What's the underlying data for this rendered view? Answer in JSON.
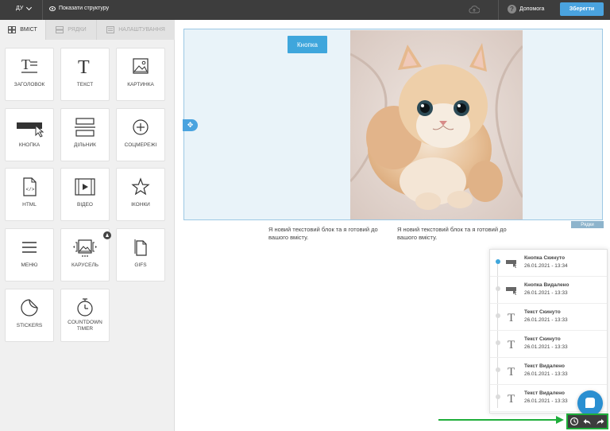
{
  "topbar": {
    "language": "ДУ",
    "show_structure": "Показати структуру",
    "help": "Допомога",
    "save": "Зберегти"
  },
  "tabs": [
    {
      "label": "ВМІСТ",
      "icon": "grid-icon",
      "active": true
    },
    {
      "label": "РЯДКИ",
      "icon": "rows-icon",
      "active": false
    },
    {
      "label": "НАЛАШТУВАННЯ",
      "icon": "settings-icon",
      "active": false
    }
  ],
  "blocks": [
    {
      "label": "ЗАГОЛОВОК",
      "icon": "heading-icon"
    },
    {
      "label": "ТЕКСТ",
      "icon": "text-icon"
    },
    {
      "label": "КАРТИНКА",
      "icon": "image-icon"
    },
    {
      "label": "КНОПКА",
      "icon": "button-icon"
    },
    {
      "label": "ДІЛЬНИК",
      "icon": "divider-icon"
    },
    {
      "label": "СОЦМЕРЕЖІ",
      "icon": "social-icon"
    },
    {
      "label": "HTML",
      "icon": "html-icon"
    },
    {
      "label": "ВІДЕО",
      "icon": "video-icon"
    },
    {
      "label": "ІКОНКИ",
      "icon": "star-icon"
    },
    {
      "label": "МЕНЮ",
      "icon": "menu-icon"
    },
    {
      "label": "КАРУСЕЛЬ",
      "icon": "carousel-icon"
    },
    {
      "label": "GIFS",
      "icon": "gifs-icon"
    },
    {
      "label": "STICKERS",
      "icon": "sticker-icon"
    },
    {
      "label": "COUNTDOWN TIMER",
      "icon": "timer-icon"
    }
  ],
  "canvas": {
    "button_label": "Кнопка",
    "rows_tag": "Рядки",
    "text_block_1": "Я новий текстовий блок та я готовий до вашого вмісту.",
    "text_block_2": "Я новий текстовий блок та я готовий до вашого вмісту."
  },
  "history": [
    {
      "title": "Кнопка Скинуто",
      "time": "26.01.2021 - 13:34",
      "icon": "button-icon",
      "active": true
    },
    {
      "title": "Кнопка Видалено",
      "time": "26.01.2021 - 13:33",
      "icon": "button-icon",
      "active": false
    },
    {
      "title": "Текст Скинуто",
      "time": "26.01.2021 - 13:33",
      "icon": "text-icon",
      "active": false
    },
    {
      "title": "Текст Скинуто",
      "time": "26.01.2021 - 13:33",
      "icon": "text-icon",
      "active": false
    },
    {
      "title": "Текст Видалено",
      "time": "26.01.2021 - 13:33",
      "icon": "text-icon",
      "active": false
    },
    {
      "title": "Текст Видалено",
      "time": "26.01.2021 - 13:33",
      "icon": "text-icon",
      "active": false
    }
  ],
  "colors": {
    "accent": "#3fa6dc",
    "topbar": "#3d3d3d",
    "highlight": "#1fae3b"
  }
}
